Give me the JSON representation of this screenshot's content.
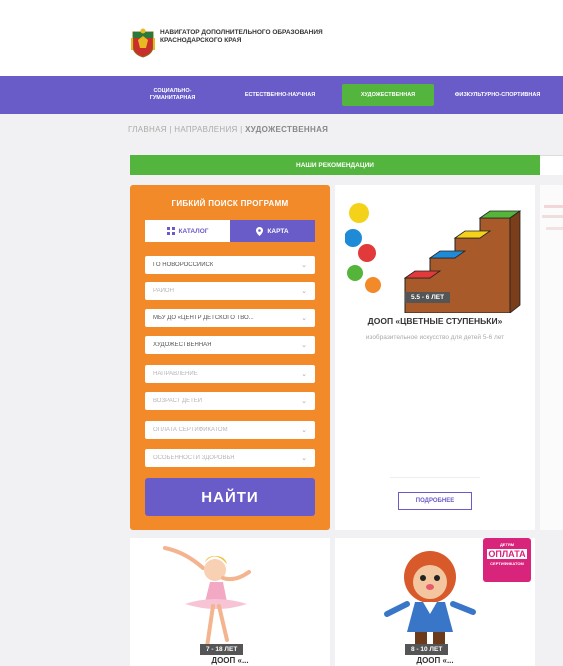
{
  "header": {
    "logo_text": "НАВИГАТОР ДОПОЛНИТЕЛЬНОГО ОБРАЗОВАНИЯ КРАСНОДАРСКОГО КРАЯ"
  },
  "nav": {
    "items": [
      {
        "label": "СОЦИАЛЬНО-ГУМАНИТАРНАЯ",
        "active": false
      },
      {
        "label": "ЕСТЕСТВЕННО-НАУЧНАЯ",
        "active": false
      },
      {
        "label": "ХУДОЖЕСТВЕННАЯ",
        "active": true
      },
      {
        "label": "ФИЗКУЛЬТУРНО-СПОРТИВНАЯ",
        "active": false
      }
    ]
  },
  "breadcrumb": {
    "home": "ГЛАВНАЯ",
    "sep1": "|",
    "directions": "НАПРАВЛЕНИЯ",
    "sep2": "|",
    "current": "ХУДОЖЕСТВЕННАЯ"
  },
  "recommend": {
    "label": "НАШИ РЕКОМЕНДАЦИИ"
  },
  "search": {
    "title": "ГИБКИЙ ПОИСК ПРОГРАММ",
    "catalog_label": "КАТАЛОГ",
    "map_label": "КАРТА",
    "selects": [
      {
        "value": "ГО НОВОРОССИЙСК",
        "placeholder": false
      },
      {
        "value": "РАЙОН",
        "placeholder": true
      },
      {
        "value": "МБУ ДО «ЦЕНТР ДЕТСКОГО ТВО...",
        "placeholder": false
      },
      {
        "value": "ХУДОЖЕСТВЕННАЯ",
        "placeholder": false
      },
      {
        "value": "НАПРАВЛЕНИЕ",
        "placeholder": true
      },
      {
        "value": "ВОЗРАСТ ДЕТЕЙ",
        "placeholder": true
      },
      {
        "value": "ОПЛАТА СЕРТИФИКАТОМ",
        "placeholder": true
      },
      {
        "value": "ОСОБЕННОСТИ ЗДОРОВЬЯ",
        "placeholder": true
      }
    ],
    "find_label": "НАЙТИ"
  },
  "cards": {
    "card1": {
      "age": "5.5 - 6 ЛЕТ",
      "title": "ДООП «ЦВЕТНЫЕ СТУПЕНЬКИ»",
      "desc": "изобразительное искусство для детей 5-6 лет",
      "more_label": "ПОДРОБНЕЕ"
    },
    "card3": {
      "age": "7 - 18 ЛЕТ",
      "title": "ДООП «..."
    },
    "card4": {
      "age": "8 - 10 ЛЕТ",
      "title": "ДООП «...",
      "badge_top": "ДЕТЯМ",
      "badge_main": "ОПЛАТА",
      "badge_bottom": "СЕРТИФИКАТОМ"
    }
  },
  "colors": {
    "nav_bg": "#6a5cc8",
    "accent_green": "#53b53d",
    "panel_orange": "#f28a2a",
    "badge_pink": "#d8247a"
  }
}
